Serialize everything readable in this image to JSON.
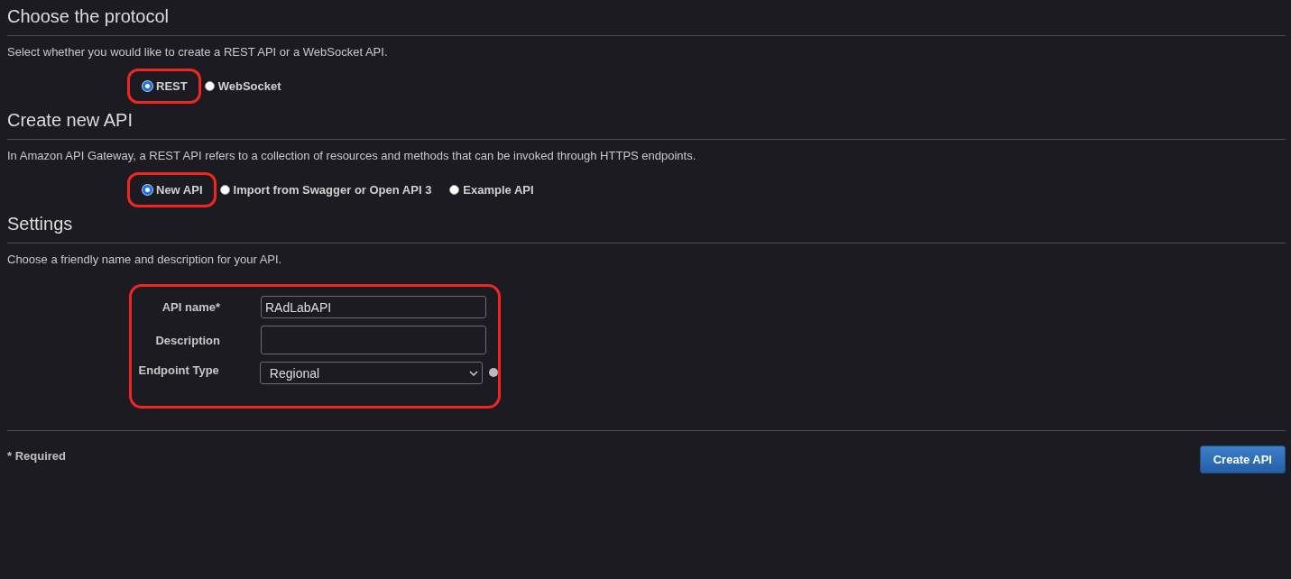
{
  "sections": [
    {
      "title": "Choose the protocol",
      "description": "Select whether you would like to create a REST API or a WebSocket API.",
      "options": [
        {
          "label": "REST",
          "selected": true,
          "highlighted": true
        },
        {
          "label": "WebSocket",
          "selected": false,
          "highlighted": false
        }
      ]
    },
    {
      "title": "Create new API",
      "description": "In Amazon API Gateway, a REST API refers to a collection of resources and methods that can be invoked through HTTPS endpoints.",
      "options": [
        {
          "label": "New API",
          "selected": true,
          "highlighted": true
        },
        {
          "label": "Import from Swagger or Open API 3",
          "selected": false,
          "highlighted": false
        },
        {
          "label": "Example API",
          "selected": false,
          "highlighted": false
        }
      ]
    },
    {
      "title": "Settings",
      "description": "Choose a friendly name and description for your API.",
      "form": {
        "highlighted": true,
        "fields": [
          {
            "kind": "text",
            "label": "API name*",
            "value": "RAdLabAPI"
          },
          {
            "kind": "textarea",
            "label": "Description"
          },
          {
            "kind": "select",
            "label": "Endpoint Type",
            "value": "Regional"
          }
        ]
      }
    }
  ],
  "footer": {
    "note": "* Required",
    "button": "Create API"
  }
}
